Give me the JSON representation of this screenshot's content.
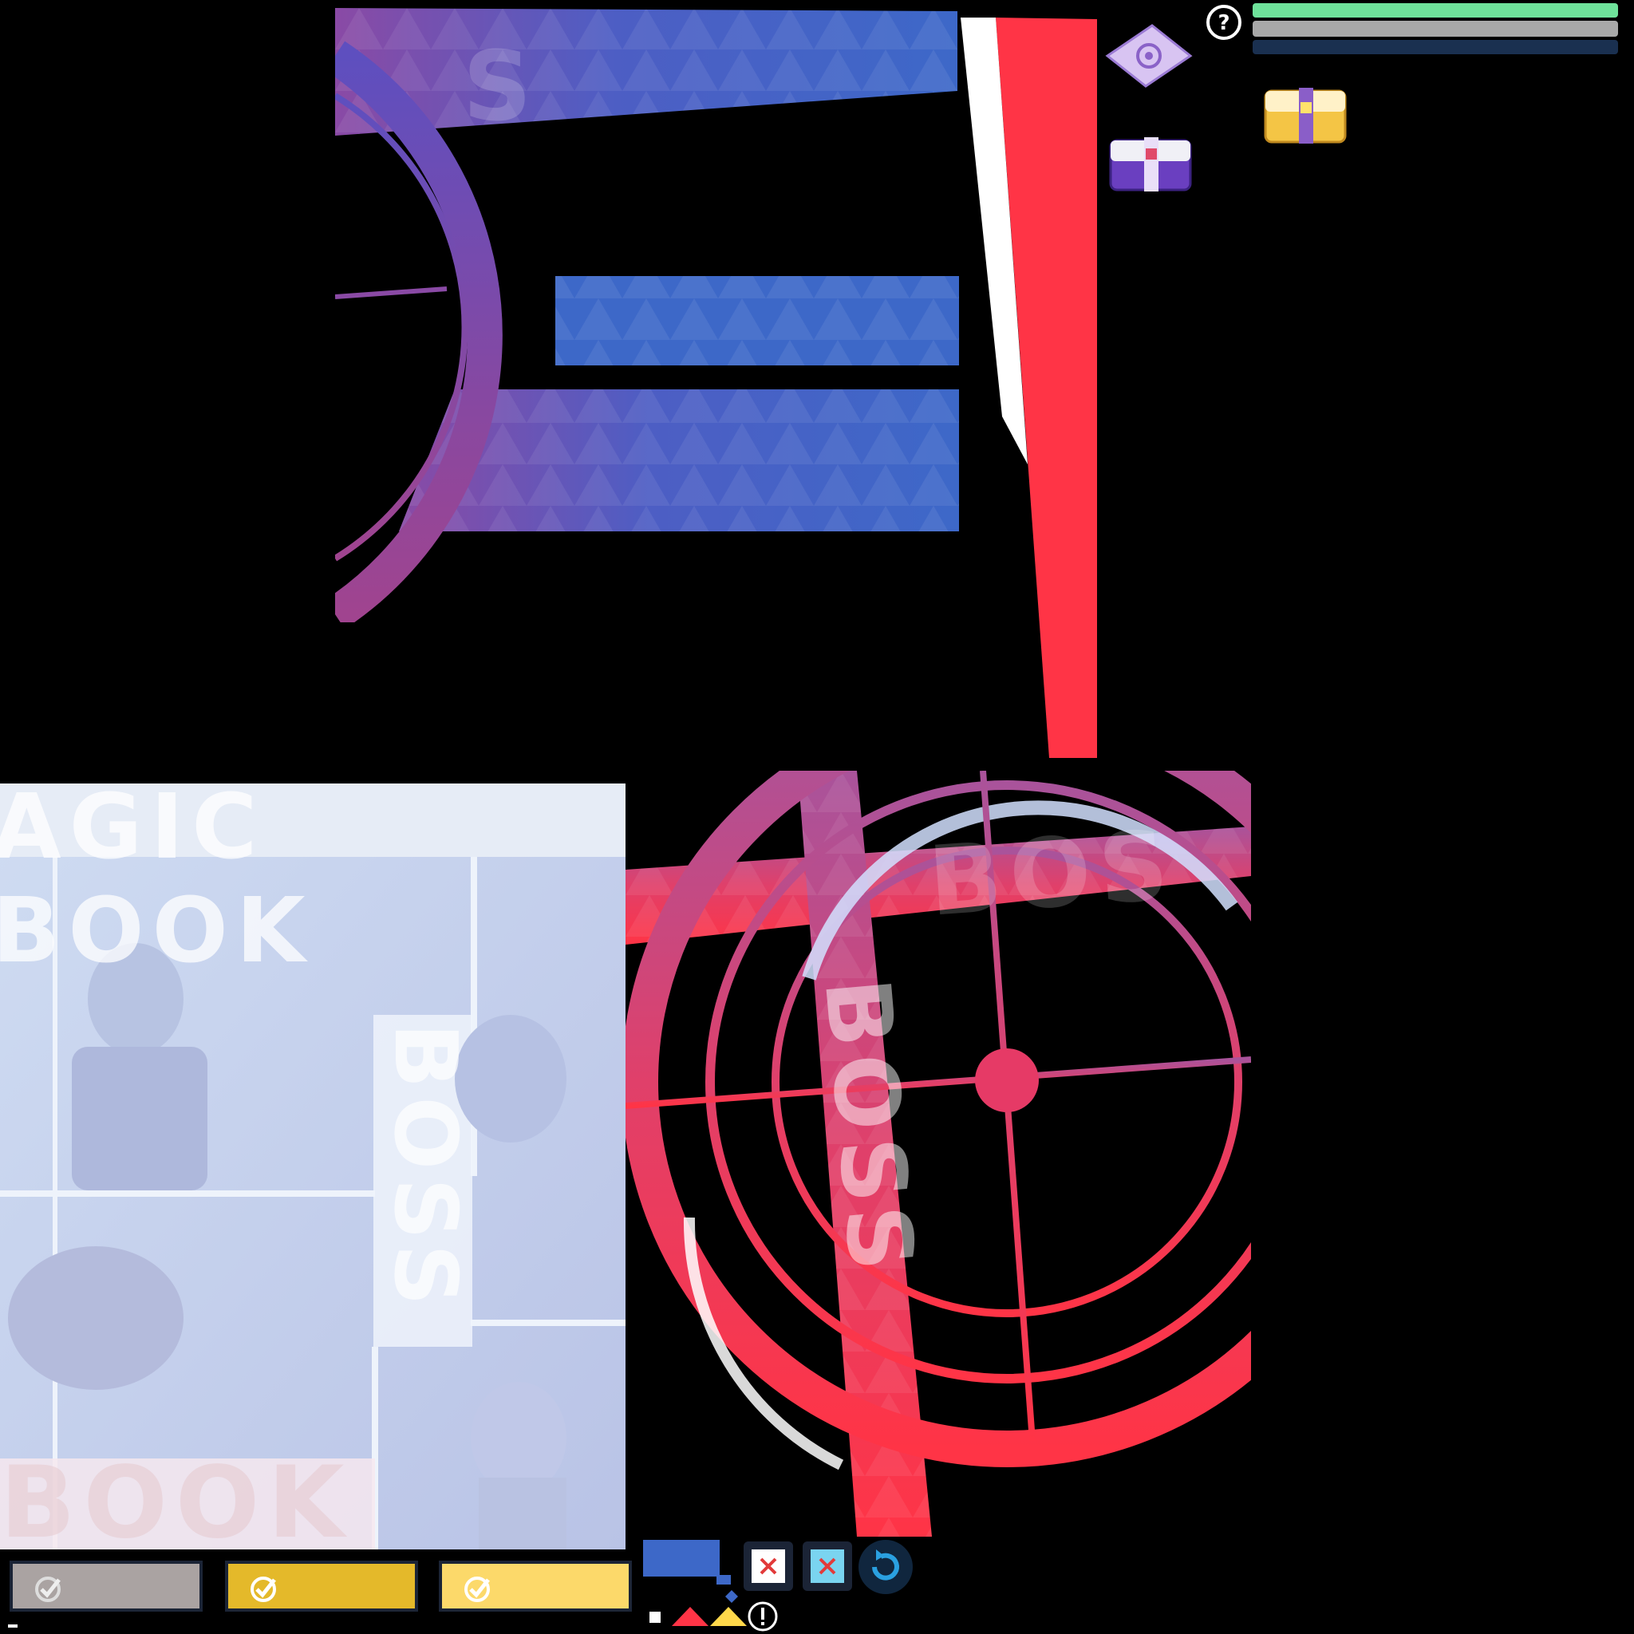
{
  "atlas": {
    "blue_top_text": "S",
    "magic_book_header": "AGIC BOOK",
    "boss_vertical_left": "BOSS",
    "book_bottom": "BOOK",
    "boss_vertical_right": "BOSS",
    "boss_top_right": "BOS"
  },
  "bars": [
    {
      "name": "green-bar",
      "color": "#6ee29a"
    },
    {
      "name": "gray-bar",
      "color": "#a8a8a8"
    },
    {
      "name": "navy-bar",
      "color": "#1a3050"
    }
  ],
  "buttons": [
    {
      "name": "confirm-button-gray",
      "color": "#aaa3a2"
    },
    {
      "name": "confirm-button-gold",
      "color": "#e4b92a"
    },
    {
      "name": "confirm-button-yellow",
      "color": "#fcd96a"
    }
  ],
  "colors": {
    "blue": "#3d68c8",
    "purple": "#8a4aa5",
    "red": "#ff3446",
    "crimson": "#e23660",
    "panel_bg": "#c8d7ef"
  },
  "icons": [
    "help-icon",
    "ticket-icon",
    "gold-chest-icon",
    "purple-chest-icon",
    "close-icon",
    "close-icon-active",
    "refresh-icon",
    "alert-icon"
  ]
}
